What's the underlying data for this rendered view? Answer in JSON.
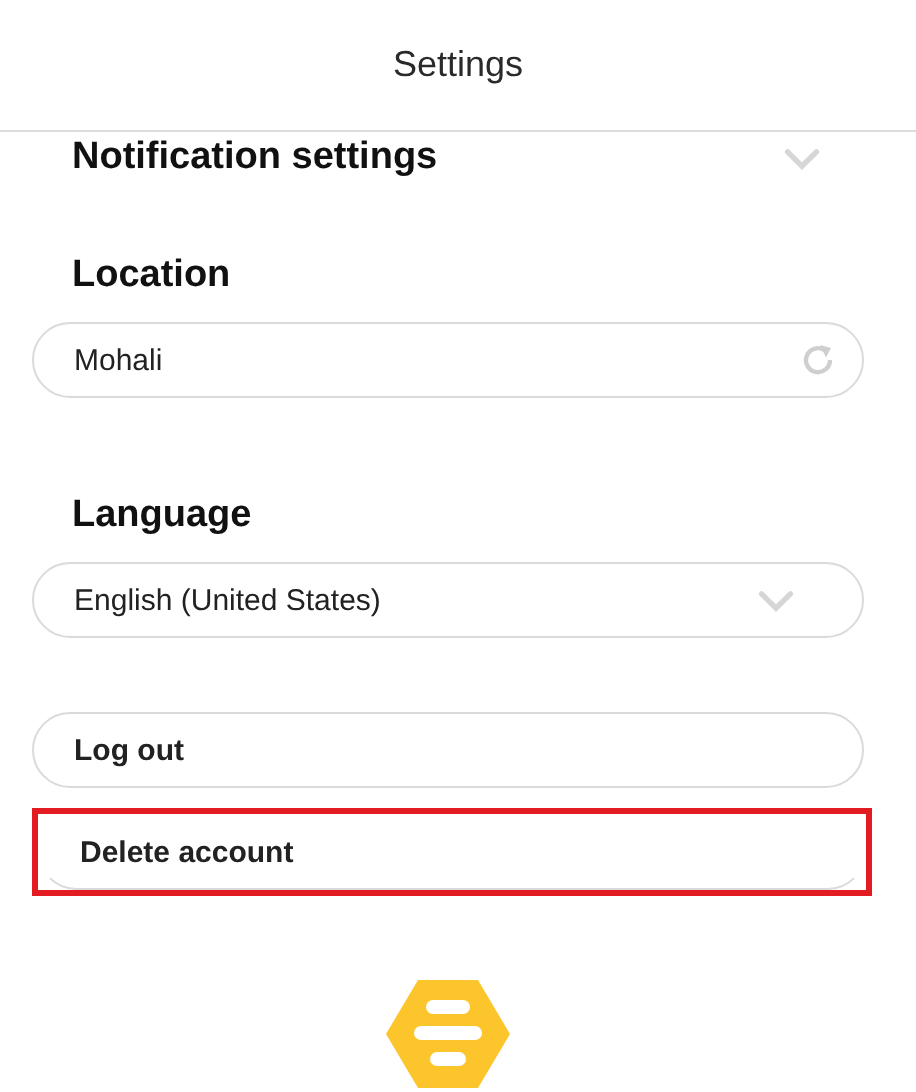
{
  "header": {
    "title": "Settings"
  },
  "sections": [
    {
      "title": "Notification settings",
      "control": {
        "kind": "collapsed"
      }
    },
    {
      "title": "Location",
      "control": {
        "kind": "field",
        "value": "Mohali"
      }
    },
    {
      "title": "Language",
      "control": {
        "kind": "dropdown",
        "value": "English (United States)"
      }
    }
  ],
  "actions": [
    {
      "label": "Log out",
      "highlighted": false
    },
    {
      "label": "Delete account",
      "highlighted": true
    }
  ]
}
